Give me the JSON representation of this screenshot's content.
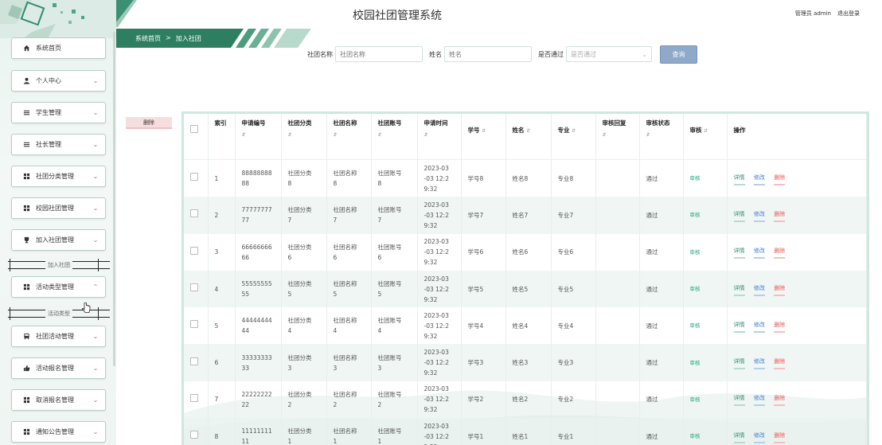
{
  "app_title": "校园社团管理系统",
  "user": {
    "name": "管理员 admin",
    "logout": "退出登录"
  },
  "breadcrumb": {
    "home": "系统首页",
    "sep": ">",
    "current": "加入社团"
  },
  "search": {
    "club_name_label": "社团名称",
    "club_name_placeholder": "社团名称",
    "name_label": "姓名",
    "name_placeholder": "姓名",
    "pass_label": "是否通过",
    "pass_placeholder": "是否通过",
    "button": "查询"
  },
  "delete_button": "删除",
  "sidebar": {
    "items": [
      {
        "label": "系统首页",
        "icon": "home-icon"
      },
      {
        "label": "个人中心",
        "icon": "user-icon"
      },
      {
        "label": "学生管理",
        "icon": "list-icon"
      },
      {
        "label": "社长管理",
        "icon": "list-icon"
      },
      {
        "label": "社团分类管理",
        "icon": "grid-icon"
      },
      {
        "label": "校园社团管理",
        "icon": "grid-icon"
      },
      {
        "label": "加入社团管理",
        "icon": "trophy-icon"
      },
      {
        "label": "活动类型管理",
        "icon": "grid-icon"
      },
      {
        "label": "社团活动管理",
        "icon": "bus-icon"
      },
      {
        "label": "活动报名管理",
        "icon": "thumb-icon"
      },
      {
        "label": "取消报名管理",
        "icon": "grid-icon"
      },
      {
        "label": "通知公告管理",
        "icon": "grid-icon"
      }
    ],
    "sub_join": "加入社团",
    "sub_activity_type": "活动类型"
  },
  "table": {
    "headers": {
      "index": "索引",
      "apply_no": "申请编号",
      "category": "社团分类",
      "club_name": "社团名称",
      "club_account": "社团账号",
      "apply_time": "申请时间",
      "student_no": "学号",
      "name": "姓名",
      "major": "专业",
      "review_reply": "审核回复",
      "review_status": "审核状态",
      "review": "审核",
      "actions": "操作"
    },
    "rows": [
      {
        "idx": "1",
        "no_a": "88888888",
        "no_b": "88",
        "cat_a": "社团分类",
        "cat_b": "8",
        "club_a": "社团名称",
        "club_b": "8",
        "acc_a": "社团账号",
        "acc_b": "8",
        "t1": "2023-03",
        "t2": "-03 12:2",
        "t3": "9:32",
        "sno": "学号8",
        "name": "姓名8",
        "major": "专业8",
        "reply": "",
        "status": "通过",
        "review": "审核"
      },
      {
        "idx": "2",
        "no_a": "77777777",
        "no_b": "77",
        "cat_a": "社团分类",
        "cat_b": "7",
        "club_a": "社团名称",
        "club_b": "7",
        "acc_a": "社团账号",
        "acc_b": "7",
        "t1": "2023-03",
        "t2": "-03 12:2",
        "t3": "9:32",
        "sno": "学号7",
        "name": "姓名7",
        "major": "专业7",
        "reply": "",
        "status": "通过",
        "review": "审核"
      },
      {
        "idx": "3",
        "no_a": "66666666",
        "no_b": "66",
        "cat_a": "社团分类",
        "cat_b": "6",
        "club_a": "社团名称",
        "club_b": "6",
        "acc_a": "社团账号",
        "acc_b": "6",
        "t1": "2023-03",
        "t2": "-03 12:2",
        "t3": "9:32",
        "sno": "学号6",
        "name": "姓名6",
        "major": "专业6",
        "reply": "",
        "status": "通过",
        "review": "审核"
      },
      {
        "idx": "4",
        "no_a": "55555555",
        "no_b": "55",
        "cat_a": "社团分类",
        "cat_b": "5",
        "club_a": "社团名称",
        "club_b": "5",
        "acc_a": "社团账号",
        "acc_b": "5",
        "t1": "2023-03",
        "t2": "-03 12:2",
        "t3": "9:32",
        "sno": "学号5",
        "name": "姓名5",
        "major": "专业5",
        "reply": "",
        "status": "通过",
        "review": "审核"
      },
      {
        "idx": "5",
        "no_a": "44444444",
        "no_b": "44",
        "cat_a": "社团分类",
        "cat_b": "4",
        "club_a": "社团名称",
        "club_b": "4",
        "acc_a": "社团账号",
        "acc_b": "4",
        "t1": "2023-03",
        "t2": "-03 12:2",
        "t3": "9:32",
        "sno": "学号4",
        "name": "姓名4",
        "major": "专业4",
        "reply": "",
        "status": "通过",
        "review": "审核"
      },
      {
        "idx": "6",
        "no_a": "33333333",
        "no_b": "33",
        "cat_a": "社团分类",
        "cat_b": "3",
        "club_a": "社团名称",
        "club_b": "3",
        "acc_a": "社团账号",
        "acc_b": "3",
        "t1": "2023-03",
        "t2": "-03 12:2",
        "t3": "9:32",
        "sno": "学号3",
        "name": "姓名3",
        "major": "专业3",
        "reply": "",
        "status": "通过",
        "review": "审核"
      },
      {
        "idx": "7",
        "no_a": "22222222",
        "no_b": "22",
        "cat_a": "社团分类",
        "cat_b": "2",
        "club_a": "社团名称",
        "club_b": "2",
        "acc_a": "社团账号",
        "acc_b": "2",
        "t1": "2023-03",
        "t2": "-03 12:2",
        "t3": "9:32",
        "sno": "学号2",
        "name": "姓名2",
        "major": "专业2",
        "reply": "",
        "status": "通过",
        "review": "审核"
      },
      {
        "idx": "8",
        "no_a": "11111111",
        "no_b": "11",
        "cat_a": "社团分类",
        "cat_b": "1",
        "club_a": "社团名称",
        "club_b": "1",
        "acc_a": "社团账号",
        "acc_b": "1",
        "t1": "2023-03",
        "t2": "-03 12:2",
        "t3": "9:32",
        "sno": "学号1",
        "name": "姓名1",
        "major": "专业1",
        "reply": "",
        "status": "通过",
        "review": "审核"
      }
    ],
    "actions": {
      "detail": "详情",
      "edit": "修改",
      "delete": "删除"
    }
  },
  "colors": {
    "accent": "#2e8c6e",
    "search_button": "#8ea9c9",
    "row_alt": "#e9f3f0",
    "delete_red": "#e55555"
  }
}
